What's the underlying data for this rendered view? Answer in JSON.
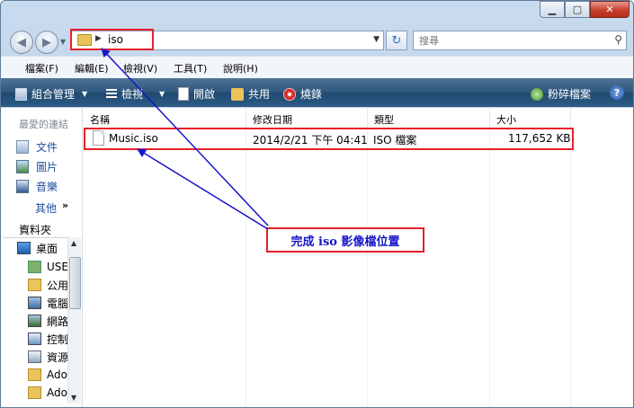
{
  "address": {
    "path": "iso"
  },
  "search": {
    "placeholder": "搜尋"
  },
  "menu": [
    "檔案(F)",
    "編輯(E)",
    "檢視(V)",
    "工具(T)",
    "說明(H)"
  ],
  "toolbar": {
    "organize": "組合管理",
    "views": "檢視",
    "open": "開啟",
    "share": "共用",
    "burn": "燒錄",
    "unpack": "粉碎檔案"
  },
  "nav": {
    "favorites_title": "最愛的連結",
    "favorites": [
      "文件",
      "圖片",
      "音樂"
    ],
    "more": "其他",
    "folders_title": "資料夾",
    "tree": [
      "桌面",
      "USE",
      "公用",
      "電腦",
      "網路",
      "控制",
      "資源",
      "Ado",
      "Ado"
    ]
  },
  "columns": [
    "名稱",
    "修改日期",
    "類型",
    "大小"
  ],
  "files": [
    {
      "name": "Music.iso",
      "date": "2014/2/21 下午 04:41",
      "type": "ISO 檔案",
      "size": "117,652 KB"
    }
  ],
  "annotation": {
    "text": "完成 iso 影像檔位置",
    "color": "#1515c8",
    "border": "#e8202a"
  }
}
